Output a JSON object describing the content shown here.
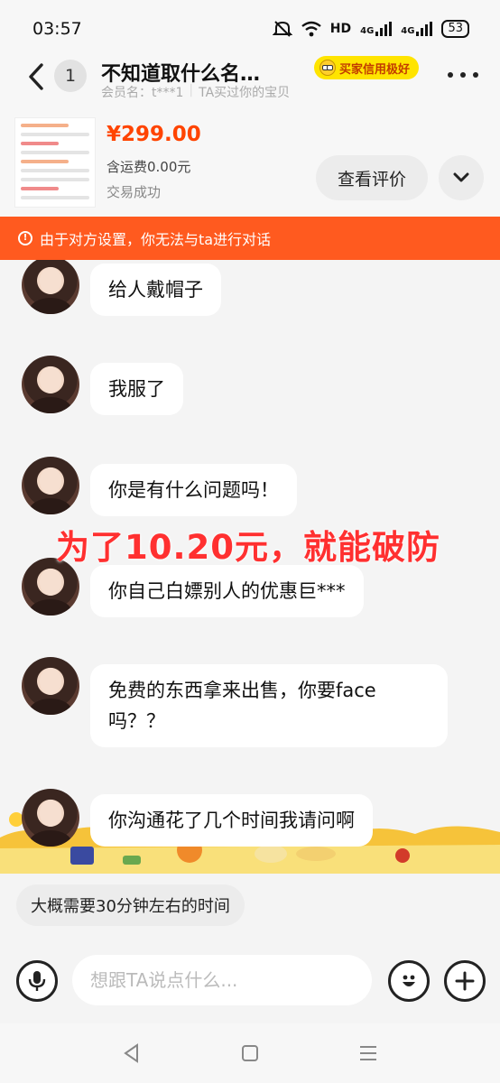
{
  "status_bar": {
    "time": "03:57",
    "network_label": "HD",
    "signal_1": "4G",
    "signal_2": "4G",
    "battery": "53"
  },
  "header": {
    "back_icon": "chevron-left-icon",
    "unread_count": "1",
    "title": "不知道取什么名…",
    "member_prefix": "会员名：",
    "member_name": "t***1",
    "bought_note": "TA买过你的宝贝",
    "credit_badge": "买家信用极好",
    "more_icon": "more-horizontal-icon"
  },
  "product": {
    "price": "¥299.00",
    "shipping": "含运费0.00元",
    "status": "交易成功",
    "review_button": "查看评价",
    "expand_icon": "chevron-down-icon"
  },
  "banner": {
    "icon": "alert-circle-icon",
    "text": "由于对方设置，你无法与ta进行对话"
  },
  "messages": [
    {
      "text": "给人戴帽子"
    },
    {
      "text": "我服了"
    },
    {
      "text": "你是有什么问题吗！"
    },
    {
      "text": "你自己白嫖别人的优惠巨***"
    },
    {
      "line1": "免费的东西拿来出售，你要face",
      "line2": "吗？？"
    },
    {
      "text": "你沟通花了几个时间我请问啊"
    }
  ],
  "overlay_caption": "为了10.20元，就能破防",
  "quick_reply": "大概需要30分钟左右的时间",
  "input": {
    "placeholder": "想跟TA说点什么...",
    "voice_icon": "microphone-icon",
    "emoji_icon": "emoji-icon",
    "add_icon": "plus-icon"
  },
  "nav": {
    "back_icon": "nav-back-icon",
    "home_icon": "nav-home-icon",
    "menu_icon": "nav-menu-icon"
  },
  "colors": {
    "accent": "#ff5a1f",
    "price": "#ff4400",
    "caption": "#ff3030",
    "badge": "#ffe400"
  }
}
